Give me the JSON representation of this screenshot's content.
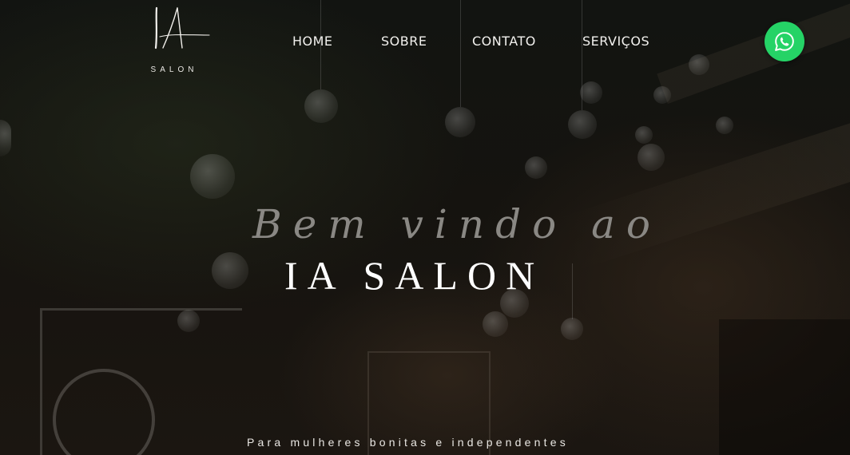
{
  "brand": {
    "logo_monogram": "IA",
    "logo_subtitle": "SALON"
  },
  "nav": {
    "items": [
      {
        "label": "HOME"
      },
      {
        "label": "SOBRE"
      },
      {
        "label": "CONTATO"
      },
      {
        "label": "SERVIÇOS"
      }
    ]
  },
  "whatsapp": {
    "icon": "whatsapp-icon",
    "color": "#25d366"
  },
  "hero": {
    "welcome": "Bem vindo ao",
    "title": "IA SALON",
    "tagline": "Para mulheres bonitas e independentes"
  }
}
